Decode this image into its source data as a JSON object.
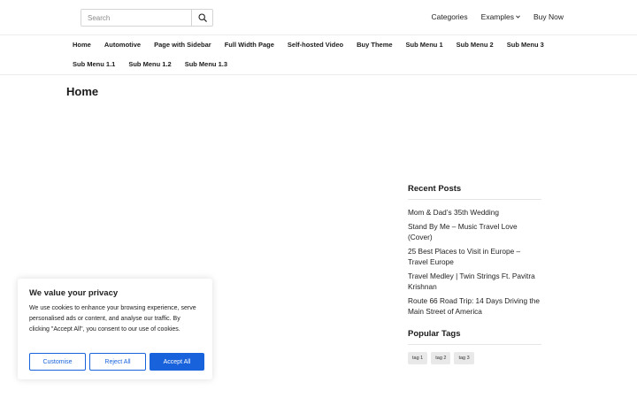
{
  "header": {
    "search": {
      "placeholder": "Search",
      "value": ""
    },
    "links": {
      "categories": "Categories",
      "examples": "Examples",
      "buy_now": "Buy Now"
    }
  },
  "nav": {
    "row1": [
      "Home",
      "Automotive",
      "Page with Sidebar",
      "Full Width Page",
      "Self-hosted Video",
      "Buy Theme",
      "Sub Menu 1",
      "Sub Menu 2",
      "Sub Menu 3"
    ],
    "row2": [
      "Sub Menu 1.1",
      "Sub Menu 1.2",
      "Sub Menu 1.3"
    ]
  },
  "page": {
    "title": "Home"
  },
  "sidebar": {
    "recent_title": "Recent Posts",
    "recent_posts": [
      "Mom & Dad’s 35th Wedding",
      "Stand By Me – Music Travel Love (Cover)",
      "25 Best Places to Visit in Europe – Travel Europe",
      "Travel Medley | Twin Strings Ft. Pavitra Krishnan",
      "Route 66 Road Trip: 14 Days Driving the Main Street of America"
    ],
    "tags_title": "Popular Tags",
    "tags": [
      "tag 1",
      "tag 2",
      "tag 3"
    ]
  },
  "cookie": {
    "title": "We value your privacy",
    "text": "We use cookies to enhance your browsing experience, serve personalised ads or content, and analyse our traffic. By clicking \"Accept All\", you consent to our use of cookies.",
    "customise": "Customise",
    "reject": "Reject All",
    "accept": "Accept All"
  },
  "icons": {
    "search": "search-icon",
    "examples_caret": "chevron-down-icon"
  },
  "colors": {
    "accent": "#1863dc",
    "tag_bg": "#e9e9e9"
  }
}
